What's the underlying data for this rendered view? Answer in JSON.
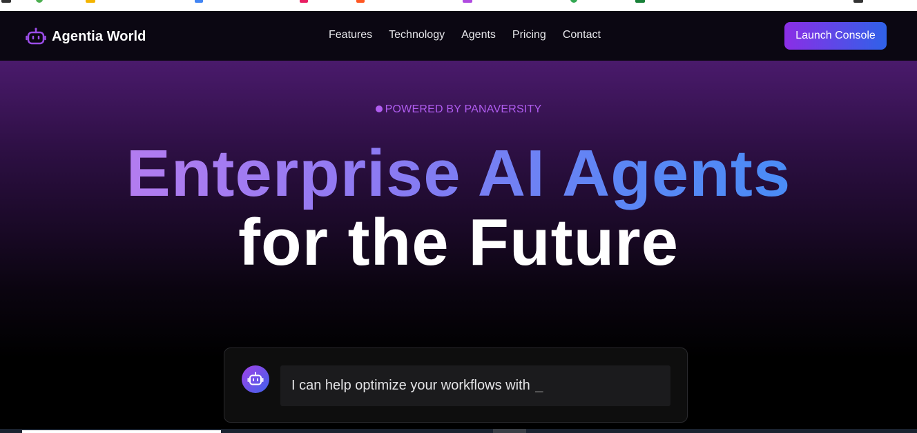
{
  "brand": {
    "name": "Agentia World",
    "icon": "robot-icon",
    "color": "#9b4de8"
  },
  "nav": {
    "links": [
      "Features",
      "Technology",
      "Agents",
      "Pricing",
      "Contact"
    ],
    "cta_label": "Launch Console"
  },
  "hero": {
    "badge": "POWERED BY PANAVERSITY",
    "headline_line1": "Enterprise AI Agents",
    "headline_line2": "for the Future"
  },
  "chat": {
    "avatar_icon": "robot-icon",
    "message": "I can help optimize your workflows with ",
    "cursor": "_"
  },
  "colors": {
    "accent_purple": "#8b2ee6",
    "accent_blue": "#2f62e8",
    "badge": "#b05df0"
  }
}
